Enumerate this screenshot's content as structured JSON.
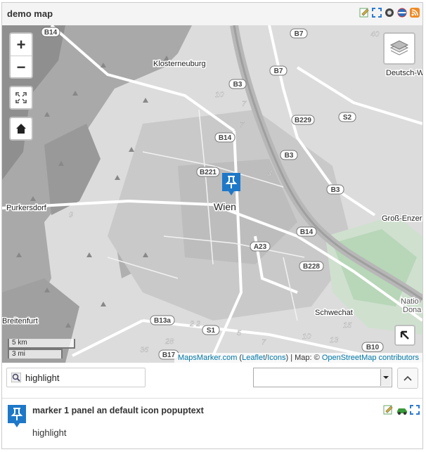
{
  "panel": {
    "title": "demo map",
    "icons": [
      "edit-icon",
      "fullscreen-icon",
      "kml-icon",
      "geo-icon",
      "rss-icon"
    ]
  },
  "map": {
    "places": {
      "klosterneuburg": "Klosterneuburg",
      "wien": "Wien",
      "purkersdorf": "Purkersdorf",
      "breitenfurt": "Breitenfurt",
      "schwechat": "Schwechat",
      "gross_enzers": "Groß-Enzers",
      "deutsch_w": "Deutsch-W",
      "natio": "Natio",
      "donau": "Dona"
    },
    "roads": [
      "B14",
      "B7",
      "B3",
      "B7",
      "S2",
      "B229",
      "B14",
      "B3",
      "B221",
      "B3",
      "B14",
      "A23",
      "B228",
      "B13a",
      "S1",
      "B17",
      "B10"
    ],
    "road_numbers": [
      "40",
      "10",
      "7",
      "7",
      "3",
      "9",
      "2",
      "2",
      "5",
      "7",
      "10",
      "15",
      "13",
      "36",
      "28"
    ],
    "scale": {
      "km": "5 km",
      "mi": "3 mi"
    },
    "attribution": {
      "mapsmarker": "MapsMarker.com",
      "paren_open": " (",
      "leaflet": "Leaflet",
      "slash": "/",
      "icons": "Icons",
      "mid": ") | Map: © ",
      "osm": "OpenStreetMap contributors"
    },
    "controls": {
      "zoom_in": "+",
      "zoom_out": "−"
    }
  },
  "search": {
    "value": "highlight",
    "select_value": "",
    "up_label": "^"
  },
  "marker": {
    "title": "marker 1 panel an default icon popuptext",
    "text": "highlight"
  },
  "colors": {
    "marker": "#1e78c8",
    "link": "#0078a8",
    "park": "#8fbf8f"
  }
}
